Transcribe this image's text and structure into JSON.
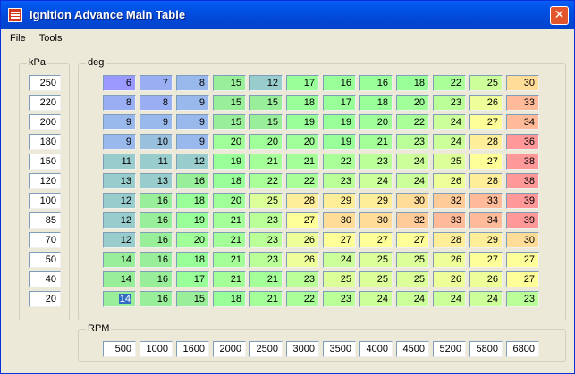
{
  "window": {
    "title": "Ignition Advance Main Table",
    "close_glyph": "✕"
  },
  "menu": [
    "File",
    "Tools"
  ],
  "groups": {
    "kpa": "kPa",
    "deg": "deg",
    "rpm": "RPM"
  },
  "kpa": [
    "250",
    "220",
    "200",
    "180",
    "150",
    "120",
    "100",
    "85",
    "70",
    "50",
    "40",
    "20"
  ],
  "rpm": [
    "500",
    "1000",
    "1600",
    "2000",
    "2500",
    "3000",
    "3500",
    "4000",
    "4500",
    "5200",
    "5800",
    "6800"
  ],
  "table": [
    [
      "6",
      "7",
      "8",
      "15",
      "12",
      "17",
      "16",
      "16",
      "18",
      "22",
      "25",
      "30"
    ],
    [
      "8",
      "8",
      "9",
      "15",
      "15",
      "18",
      "17",
      "18",
      "20",
      "23",
      "26",
      "33"
    ],
    [
      "9",
      "9",
      "9",
      "15",
      "15",
      "19",
      "19",
      "20",
      "22",
      "24",
      "27",
      "34"
    ],
    [
      "9",
      "10",
      "9",
      "20",
      "20",
      "20",
      "19",
      "21",
      "23",
      "24",
      "28",
      "36"
    ],
    [
      "11",
      "11",
      "12",
      "19",
      "21",
      "21",
      "22",
      "23",
      "24",
      "25",
      "27",
      "38"
    ],
    [
      "13",
      "13",
      "16",
      "18",
      "22",
      "22",
      "23",
      "24",
      "24",
      "26",
      "28",
      "38"
    ],
    [
      "12",
      "16",
      "18",
      "20",
      "25",
      "28",
      "29",
      "29",
      "30",
      "32",
      "33",
      "39"
    ],
    [
      "12",
      "16",
      "19",
      "21",
      "23",
      "27",
      "30",
      "30",
      "32",
      "33",
      "34",
      "39"
    ],
    [
      "12",
      "16",
      "20",
      "21",
      "23",
      "26",
      "27",
      "27",
      "27",
      "28",
      "29",
      "30"
    ],
    [
      "14",
      "16",
      "18",
      "21",
      "23",
      "26",
      "24",
      "25",
      "25",
      "26",
      "27",
      "27"
    ],
    [
      "14",
      "16",
      "17",
      "21",
      "21",
      "23",
      "25",
      "25",
      "25",
      "26",
      "26",
      "27"
    ],
    [
      "14",
      "16",
      "15",
      "18",
      "21",
      "22",
      "23",
      "24",
      "24",
      "24",
      "24",
      "23"
    ]
  ],
  "selected_cell": {
    "row": 11,
    "col": 0
  },
  "colors": {
    "titlebar": "#0055ea",
    "window_bg": "#ece9d8",
    "selection": "#316ac5",
    "cell_colors": [
      [
        "#9999ff",
        "#9aaef3",
        "#99b9ec",
        "#99ee99",
        "#99cccc",
        "#99ff99",
        "#99ff99",
        "#99ff99",
        "#99ff99",
        "#aaff99",
        "#ccff99",
        "#ffdd99"
      ],
      [
        "#9aaef3",
        "#9aaef3",
        "#99b9ec",
        "#99ee99",
        "#99ee99",
        "#99ff99",
        "#99ff99",
        "#99ff99",
        "#a0ff99",
        "#bbff99",
        "#eeff99",
        "#ffbb99"
      ],
      [
        "#99b9ec",
        "#99b9ec",
        "#99b9ec",
        "#99ee99",
        "#99ee99",
        "#99ff99",
        "#99ff99",
        "#a0ff99",
        "#aaff99",
        "#ccff99",
        "#ffff99",
        "#ffbb99"
      ],
      [
        "#99b9ec",
        "#99c0dc",
        "#99b9ec",
        "#a0ff99",
        "#a0ff99",
        "#a0ff99",
        "#99ff99",
        "#a5ff99",
        "#bbff99",
        "#ccff99",
        "#ffee99",
        "#ff9999"
      ],
      [
        "#99cccc",
        "#99cccc",
        "#99cccc",
        "#99ff99",
        "#a5ff99",
        "#a5ff99",
        "#aaff99",
        "#bbff99",
        "#ccff99",
        "#ddff99",
        "#ffff99",
        "#ff9999"
      ],
      [
        "#99cccc",
        "#99cccc",
        "#99ee99",
        "#99ff99",
        "#aaff99",
        "#aaff99",
        "#bbff99",
        "#ccff99",
        "#ccff99",
        "#eeff99",
        "#ffee99",
        "#ff9999"
      ],
      [
        "#99cccc",
        "#99ee99",
        "#99ff99",
        "#a0ff99",
        "#ddff99",
        "#ffee99",
        "#ffee99",
        "#ffee99",
        "#ffdd99",
        "#ffcc99",
        "#ffbb99",
        "#ff9999"
      ],
      [
        "#99cccc",
        "#99ee99",
        "#99ff99",
        "#a5ff99",
        "#bbff99",
        "#ffff99",
        "#ffdd99",
        "#ffdd99",
        "#ffcc99",
        "#ffbb99",
        "#ffbb99",
        "#ff9999"
      ],
      [
        "#99cccc",
        "#99ee99",
        "#a0ff99",
        "#a5ff99",
        "#bbff99",
        "#eeff99",
        "#ffff99",
        "#ffff99",
        "#ffff99",
        "#ffee99",
        "#ffee99",
        "#ffdd99"
      ],
      [
        "#99ee99",
        "#99ee99",
        "#99ff99",
        "#a5ff99",
        "#bbff99",
        "#eeff99",
        "#ccff99",
        "#ddff99",
        "#ddff99",
        "#eeff99",
        "#ffff99",
        "#ffff99"
      ],
      [
        "#99ee99",
        "#99ee99",
        "#99ff99",
        "#a5ff99",
        "#a5ff99",
        "#bbff99",
        "#ddff99",
        "#ddff99",
        "#ddff99",
        "#eeff99",
        "#eeff99",
        "#ffff99"
      ],
      [
        "#99ee99",
        "#99ee99",
        "#99ee99",
        "#99ff99",
        "#a5ff99",
        "#aaff99",
        "#bbff99",
        "#ccff99",
        "#ccff99",
        "#ccff99",
        "#ccff99",
        "#bbff99"
      ]
    ]
  }
}
